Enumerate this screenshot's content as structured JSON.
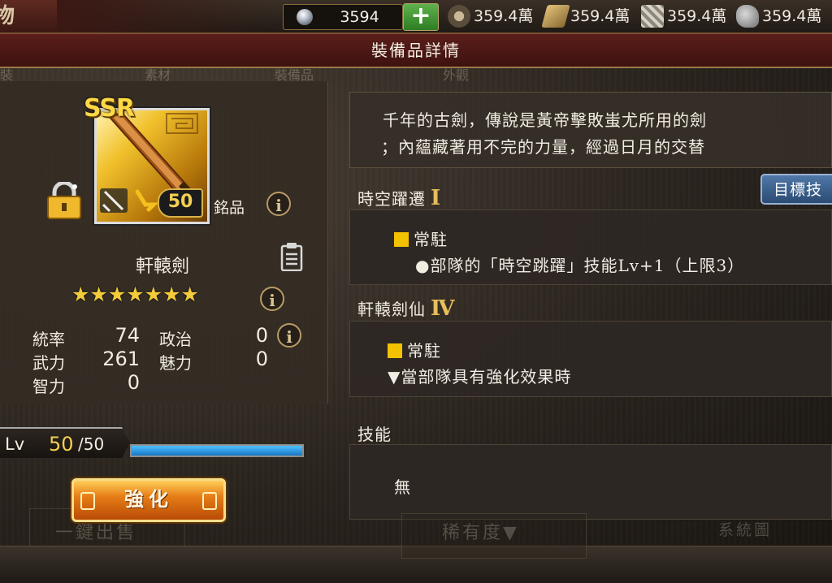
{
  "top_bar": {
    "corner_title": "物",
    "gems": "3594",
    "add_gems_label": "+",
    "resources": [
      {
        "icon": "food-icon",
        "value": "359.4萬"
      },
      {
        "icon": "wood-icon",
        "value": "359.4萬"
      },
      {
        "icon": "iron-icon",
        "value": "359.4萬"
      },
      {
        "icon": "stone-icon",
        "value": "359.4萬"
      }
    ]
  },
  "title": "裝備品詳情",
  "equipment": {
    "rarity": "SSR",
    "level_badge": "50",
    "quality": "銘品",
    "name": "軒轅劍",
    "stars": "★★★★★★★",
    "star_count": 7,
    "stats": [
      {
        "label": "統率",
        "value": "74"
      },
      {
        "label": "政治",
        "value": "0"
      },
      {
        "label": "武力",
        "value": "261"
      },
      {
        "label": "魅力",
        "value": "0"
      },
      {
        "label": "智力",
        "value": "0"
      }
    ],
    "lv_label": "Lv",
    "lv_current": "50",
    "lv_max": "/50",
    "exp_fraction": 1.0,
    "enhance_button": "強化"
  },
  "description": [
    "千年的古劍，傳說是黃帝擊敗蚩尤所用的劍",
    "；內蘊藏著用不完的力量，經過日月的交替"
  ],
  "target_button": "目標技",
  "sections": [
    {
      "title": "時空躍遷",
      "rank": "Ⅰ",
      "tag": "常駐",
      "line": "●部隊的「時空跳躍」技能Lv+1（上限3）"
    },
    {
      "title": "軒轅劍仙",
      "rank": "Ⅳ",
      "tag": "常駐",
      "line": "▼當部隊具有強化效果時"
    }
  ],
  "skill": {
    "title": "技能",
    "value": "無"
  },
  "ghost_texts": {
    "tabs": [
      "裝",
      "素材",
      "裝備品",
      "外觀"
    ],
    "sell_button": "一鍵出售",
    "rarity_sort": "稀有度▼",
    "system_map": "系統圖"
  },
  "colors": {
    "accent_gold": "#f3d054",
    "title_banner": "#5a1e1a",
    "exp_bar": "#1f8ee0",
    "enhance_button": "#e67e17",
    "target_button": "#3a5f8c"
  }
}
